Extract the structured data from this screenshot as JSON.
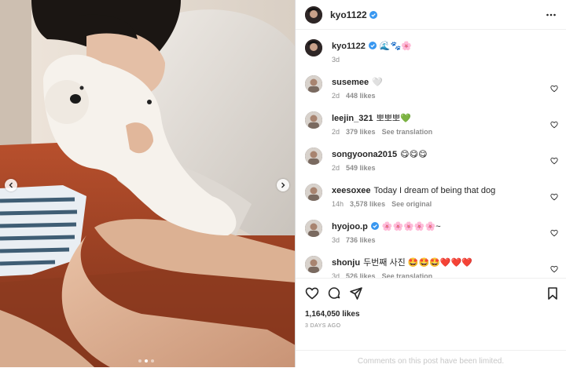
{
  "post": {
    "author": "kyo1122",
    "caption": {
      "text": "🌊🐾🌸",
      "time": "3d"
    },
    "comments": [
      {
        "user": "susemee",
        "text": "🤍",
        "time": "2d",
        "likes": "448 likes",
        "action": ""
      },
      {
        "user": "leejin_321",
        "text": "뽀뽀뽀💚",
        "time": "2d",
        "likes": "379 likes",
        "action": "See translation"
      },
      {
        "user": "songyoona2015",
        "text": "😋😋😋",
        "time": "2d",
        "likes": "549 likes",
        "action": ""
      },
      {
        "user": "xeesoxee",
        "text": "Today I dream of being that dog",
        "time": "14h",
        "likes": "3,578 likes",
        "action": "See original"
      },
      {
        "user": "hyojoo.p",
        "text": "🌸🌸🌸🌸🌸~",
        "time": "3d",
        "likes": "736 likes",
        "action": ""
      },
      {
        "user": "shonju",
        "text": "두번째 사진 🤩🤩🤩❤️❤️❤️",
        "time": "3d",
        "likes": "526 likes",
        "action": "See translation"
      }
    ],
    "likes_count": "1,164,050 likes",
    "posted_ago": "3 DAYS AGO",
    "comments_limited": "Comments on this post have been limited."
  },
  "media": {
    "carousel_dots": 3,
    "active_dot": 1
  },
  "icons": {
    "verified": "verified-badge-icon",
    "more": "more-options-icon",
    "like": "heart-icon",
    "comment": "comment-icon",
    "share": "share-icon",
    "save": "bookmark-icon",
    "prev": "chevron-left-icon",
    "next": "chevron-right-icon"
  },
  "colors": {
    "verified_blue": "#3897f0",
    "meta_gray": "#8e8e8e",
    "divider": "#efefef"
  }
}
